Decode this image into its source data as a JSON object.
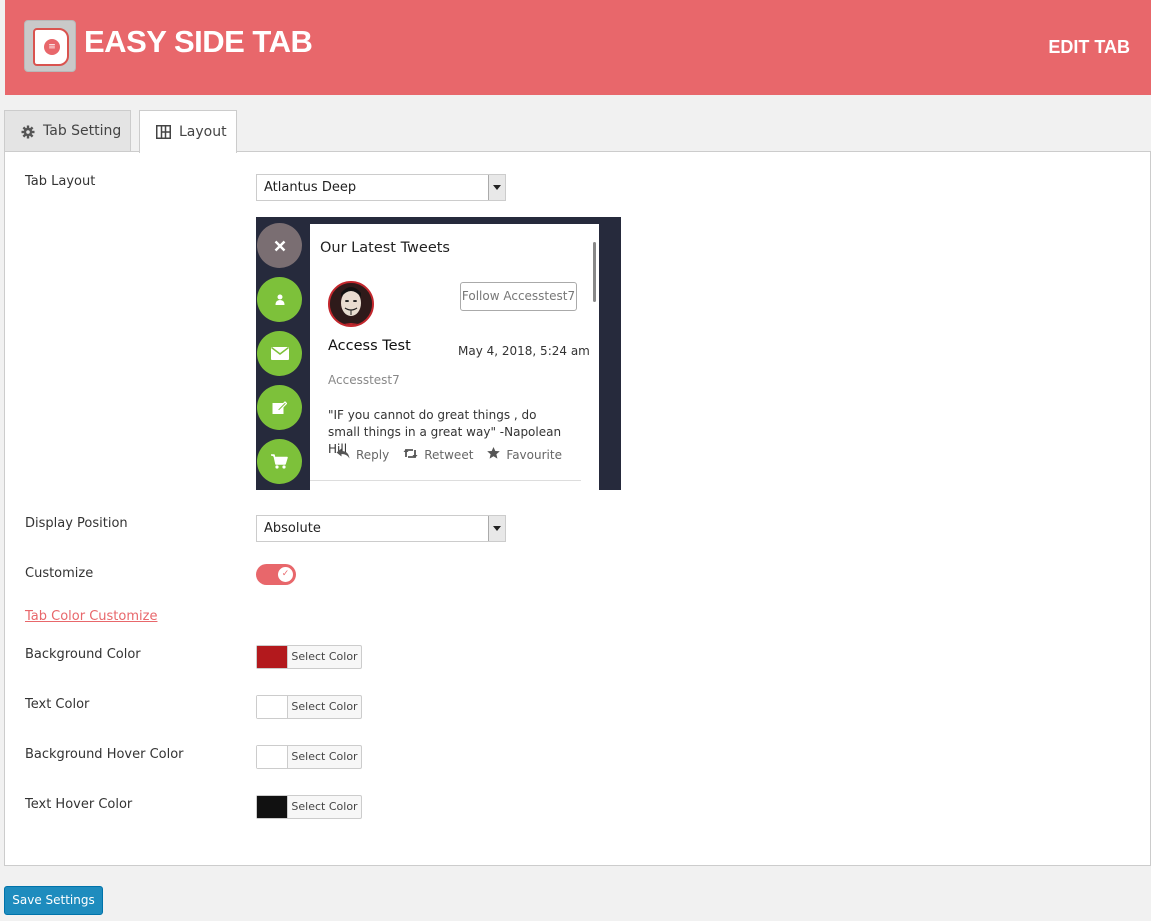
{
  "header": {
    "app_title": "EASY SIDE TAB",
    "edit_label": "EDIT TAB",
    "bg_color": "#e8676b"
  },
  "tabs": [
    {
      "label": "Tab Setting",
      "icon": "gear-icon",
      "active": false
    },
    {
      "label": "Layout",
      "icon": "layout-grid-icon",
      "active": true
    }
  ],
  "form": {
    "tab_layout": {
      "label": "Tab Layout",
      "value": "Atlantus Deep"
    },
    "display_position": {
      "label": "Display Position",
      "value": "Absolute"
    },
    "customize": {
      "label": "Customize",
      "enabled": true
    },
    "color_link": "Tab Color Customize",
    "colors": [
      {
        "label": "Background Color",
        "button": "Select Color",
        "swatch": "#b3191d"
      },
      {
        "label": "Text Color",
        "button": "Select Color",
        "swatch": "#ffffff"
      },
      {
        "label": "Background Hover Color",
        "button": "Select Color",
        "swatch": "#ffffff"
      },
      {
        "label": "Text Hover Color",
        "button": "Select Color",
        "swatch": "#111111"
      }
    ]
  },
  "preview": {
    "title": "Our Latest Tweets",
    "follow_label": "Follow Accesstest7",
    "name": "Access Test",
    "date": "May 4, 2018, 5:24 am",
    "handle": "Accesstest7",
    "tweet_text": "\"IF you cannot do great things , do small things in a great way\" -Napolean Hill",
    "actions": {
      "reply": "Reply",
      "retweet": "Retweet",
      "favourite": "Favourite"
    },
    "side_icons": [
      "close-icon",
      "user-icon",
      "mail-icon",
      "edit-icon",
      "cart-icon"
    ]
  },
  "save_label": "Save Settings"
}
